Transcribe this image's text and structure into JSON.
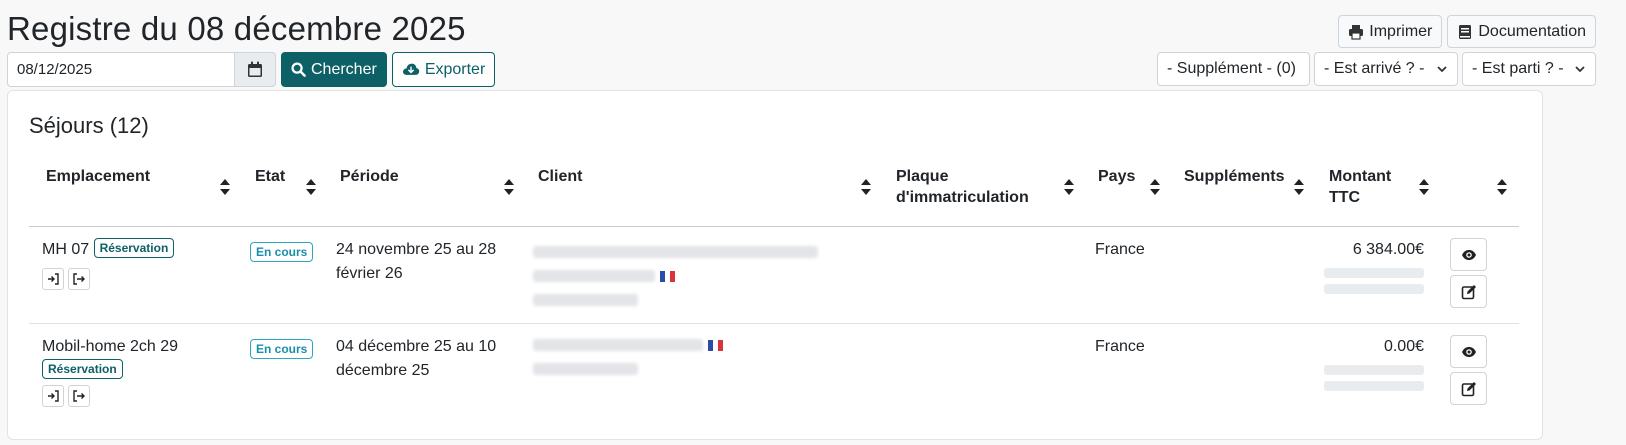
{
  "page": {
    "title": "Registre du 08 décembre 2025"
  },
  "toolbar": {
    "print_label": "Imprimer",
    "doc_label": "Documentation",
    "date_value": "08/12/2025",
    "search_label": "Chercher",
    "export_label": "Exporter"
  },
  "filters": {
    "supplement": "- Supplément - (0)",
    "arrived": "- Est arrivé ? -",
    "departed": "- Est parti ? -"
  },
  "stays": {
    "title": "Séjours (12)",
    "columns": {
      "emplacement": "Emplacement",
      "etat": "Etat",
      "periode": "Période",
      "client": "Client",
      "plaque_line1": "Plaque",
      "plaque_line2": "d'immatriculation",
      "pays": "Pays",
      "supplements": "Suppléments",
      "montant_line1": "Montant",
      "montant_line2": "TTC"
    },
    "rows": [
      {
        "emplacement": "MH 07",
        "badge": "Réservation",
        "etat": "En cours",
        "periode_line1": "24 novembre 25 au 28",
        "periode_line2": "février 26",
        "pays": "France",
        "montant": "6 384.00€"
      },
      {
        "emplacement": "Mobil-home 2ch 29",
        "badge": "Réservation",
        "etat": "En cours",
        "periode_line1": "04 décembre 25 au 10",
        "periode_line2": "décembre 25",
        "pays": "France",
        "montant": "0.00€"
      }
    ]
  },
  "colors": {
    "primary": "#0d6066",
    "info": "#2aa7c3"
  },
  "icons": [
    "print-icon",
    "book-icon",
    "calendar-icon",
    "search-icon",
    "cloud-download-icon",
    "chevron-down-icon",
    "sort-icon",
    "arrive-icon",
    "depart-icon",
    "eye-icon",
    "edit-icon",
    "french-flag-icon"
  ]
}
